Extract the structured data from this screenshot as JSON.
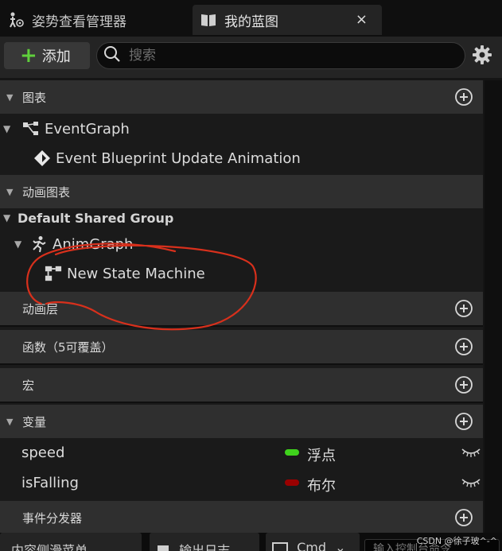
{
  "tabs": {
    "inactive_label": "姿势查看管理器",
    "active_label": "我的蓝图",
    "close_glyph": "×"
  },
  "toolbar": {
    "add_label": "添加",
    "search_placeholder": "搜索",
    "settings_icon": "gear-icon"
  },
  "sections": {
    "graphs": "图表",
    "anim_graphs": "动画图表",
    "anim_layers": "动画层",
    "functions": "函数（5可覆盖）",
    "macros": "宏",
    "variables": "变量",
    "event_dispatchers": "事件分发器"
  },
  "graphs": {
    "event_graph": "EventGraph",
    "event_update": "Event Blueprint Update Animation"
  },
  "anim_graphs": {
    "group": "Default Shared Group",
    "anim_graph": "AnimGraph",
    "state_machine": "New State Machine"
  },
  "variables": [
    {
      "name": "speed",
      "type": "浮点",
      "color": "#3fd21c"
    },
    {
      "name": "isFalling",
      "type": "布尔",
      "color": "#9a0000"
    }
  ],
  "statusbar": {
    "content_drawer": "内容侧滑菜单",
    "output_log": "输出日志",
    "cmd": "Cmd",
    "console_placeholder": "输入控制台命令"
  },
  "watermark": "CSDN @徐子玻^-^",
  "colors": {
    "accent_green": "#5fcf3c",
    "annotation_red": "#d8301c"
  }
}
